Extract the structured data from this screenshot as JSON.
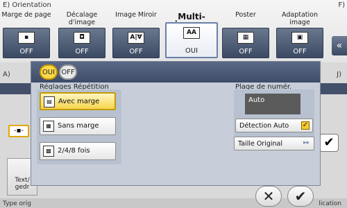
{
  "header": {
    "section_title": "E) Orientation",
    "right_label": "F)"
  },
  "tiles": [
    {
      "label": "Marge de page",
      "state": "OFF",
      "icon": "margin-icon",
      "glyph": "▪"
    },
    {
      "label": "Décalage d'image",
      "state": "OFF",
      "icon": "image-shift-icon",
      "glyph": "◘"
    },
    {
      "label": "Image Miroir",
      "state": "OFF",
      "icon": "mirror-icon",
      "glyph": "A|∀"
    },
    {
      "label": "Multi-images",
      "state": "OUI",
      "icon": "multi-image-icon",
      "glyph": "AA"
    },
    {
      "label": "Poster",
      "state": "OFF",
      "icon": "poster-icon",
      "glyph": "▦"
    },
    {
      "label": "Adaptation image",
      "state": "OFF",
      "icon": "image-adapt-icon",
      "glyph": "▣"
    }
  ],
  "background": {
    "row_a": "A)",
    "row_j": "J)",
    "text_tile": "Text/ gedr",
    "bottom_left": "Type orig",
    "bottom_right": "lication"
  },
  "dialog": {
    "toggle_on": "OUI",
    "toggle_off": "OFF",
    "repeat_label": "Réglages Répétition",
    "options": [
      {
        "label": "Avec marge",
        "icon": "with-margin-icon",
        "glyph": "▤",
        "selected": true
      },
      {
        "label": "Sans marge",
        "icon": "no-margin-icon",
        "glyph": "▦",
        "selected": false
      },
      {
        "label": "2/4/8 fois",
        "icon": "repeat-count-icon",
        "glyph": "▩",
        "selected": false
      }
    ],
    "numbering_label": "Plage de numér.",
    "numbering_value": "Auto",
    "auto_detect_label": "Détection Auto",
    "auto_detect_checked": true,
    "original_size_label": "Taille Original"
  },
  "actions": {
    "cancel_glyph": "✕",
    "ok_glyph": "✔"
  },
  "colors": {
    "accent": "#f6d54b",
    "header_blue": "#3e4c68",
    "panel": "#c7ced9"
  }
}
